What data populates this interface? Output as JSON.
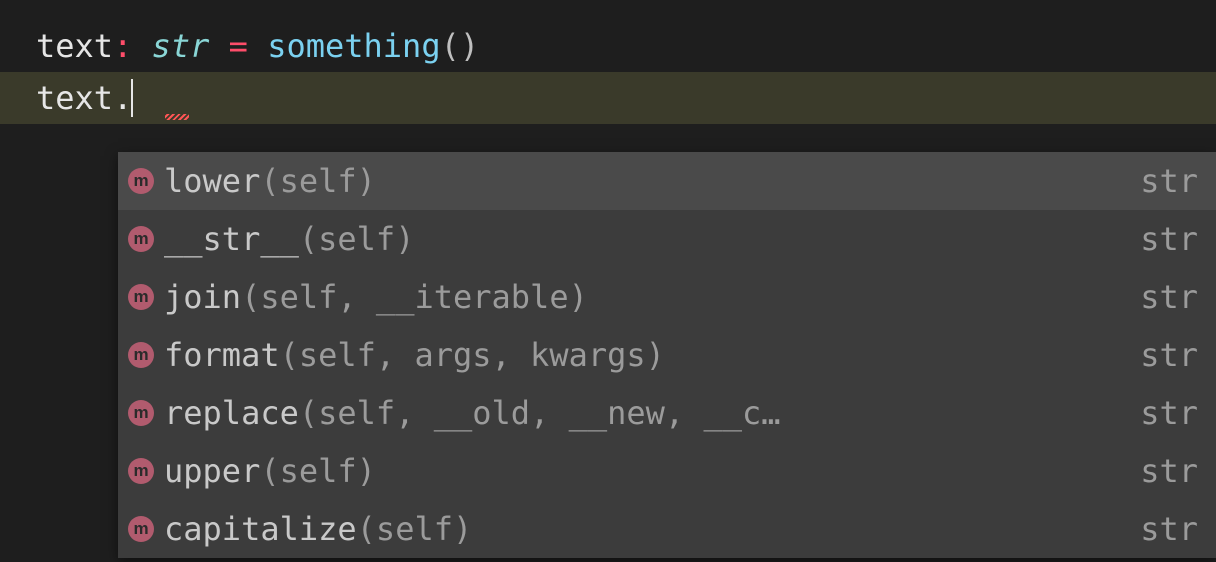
{
  "code": {
    "line1": {
      "ident": "text",
      "colon": ":",
      "type": "str",
      "op": "=",
      "call": "something",
      "parens": "()"
    },
    "line2": {
      "ident": "text",
      "dot": "."
    }
  },
  "autocomplete": {
    "icon_glyph": "m",
    "items": [
      {
        "name": "lower",
        "params": "(self)",
        "returns": "str",
        "selected": true
      },
      {
        "name": "__str__",
        "params": "(self)",
        "returns": "str",
        "selected": false
      },
      {
        "name": "join",
        "params": "(self, __iterable)",
        "returns": "str",
        "selected": false
      },
      {
        "name": "format",
        "params": "(self, args, kwargs)",
        "returns": "str",
        "selected": false
      },
      {
        "name": "replace",
        "params": "(self, __old, __new, __c…",
        "returns": "str",
        "selected": false
      },
      {
        "name": "upper",
        "params": "(self)",
        "returns": "str",
        "selected": false
      },
      {
        "name": "capitalize",
        "params": "(self)",
        "returns": "str",
        "selected": false
      }
    ]
  }
}
